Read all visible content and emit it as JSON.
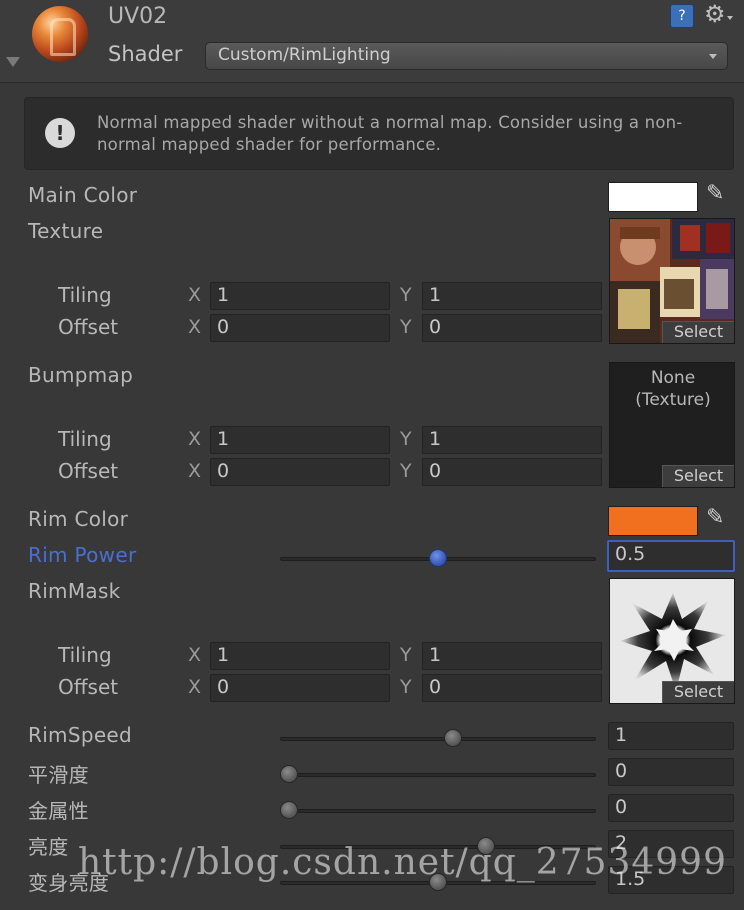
{
  "header": {
    "material_name": "UV02",
    "shader_label": "Shader",
    "shader_value": "Custom/RimLighting",
    "help_glyph": "?",
    "gear_glyph": "⚙"
  },
  "warning": {
    "icon_glyph": "!",
    "text": "Normal mapped shader without a normal map. Consider using a non-normal mapped shader for performance."
  },
  "properties": {
    "main_color": {
      "label": "Main Color",
      "color": "#ffffff"
    },
    "texture": {
      "label": "Texture",
      "tiling_label": "Tiling",
      "offset_label": "Offset",
      "tiling_x": "1",
      "tiling_y": "1",
      "offset_x": "0",
      "offset_y": "0",
      "select_label": "Select"
    },
    "bumpmap": {
      "label": "Bumpmap",
      "none_line1": "None",
      "none_line2": "(Texture)",
      "tiling_label": "Tiling",
      "offset_label": "Offset",
      "tiling_x": "1",
      "tiling_y": "1",
      "offset_x": "0",
      "offset_y": "0",
      "select_label": "Select"
    },
    "rim_color": {
      "label": "Rim Color",
      "color": "#f07020"
    },
    "rim_power": {
      "label": "Rim Power",
      "value": "0.5",
      "fraction": 0.5
    },
    "rim_mask": {
      "label": "RimMask",
      "tiling_label": "Tiling",
      "offset_label": "Offset",
      "tiling_x": "1",
      "tiling_y": "1",
      "offset_x": "0",
      "offset_y": "0",
      "select_label": "Select"
    },
    "rim_speed": {
      "label": "RimSpeed",
      "value": "1",
      "fraction": 0.55
    },
    "smoothness": {
      "label": "平滑度",
      "value": "0",
      "fraction": 0.0
    },
    "metallic": {
      "label": "金属性",
      "value": "0",
      "fraction": 0.0
    },
    "brightness": {
      "label": "亮度",
      "value": "2",
      "fraction": 0.66
    },
    "transform_brightness": {
      "label": "变身亮度",
      "value": "1.5",
      "fraction": 0.5
    }
  },
  "axis_labels": {
    "x": "X",
    "y": "Y"
  },
  "picker_glyph": "✎",
  "watermark": "http://blog.csdn.net/qq_27534999"
}
